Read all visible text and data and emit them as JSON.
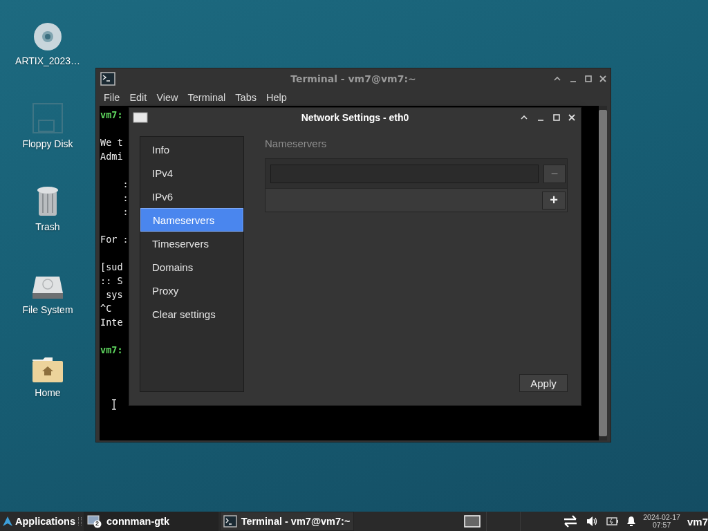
{
  "desktop_icons": [
    {
      "label": "ARTIX_2023…",
      "kind": "disc"
    },
    {
      "label": "Floppy Disk",
      "kind": "floppy"
    },
    {
      "label": "Trash",
      "kind": "trash"
    },
    {
      "label": "File System",
      "kind": "drive"
    },
    {
      "label": "Home",
      "kind": "home"
    }
  ],
  "terminal": {
    "title": "Terminal - vm7@vm7:~",
    "menu": [
      "File",
      "Edit",
      "View",
      "Terminal",
      "Tabs",
      "Help"
    ],
    "blocks": [
      {
        "lines": [
          {
            "text": "vm7:",
            "kind": "prompt"
          }
        ]
      },
      {
        "lines": [
          {
            "text": "We t",
            "kind": "output"
          },
          {
            "text": "Admi",
            "kind": "output"
          }
        ]
      },
      {
        "lines": [
          {
            "text": "    :",
            "kind": "output"
          },
          {
            "text": "    :",
            "kind": "output"
          },
          {
            "text": "    :",
            "kind": "output"
          }
        ]
      },
      {
        "lines": [
          {
            "text": "For :",
            "kind": "output"
          }
        ]
      },
      {
        "lines": [
          {
            "text": "[sud",
            "kind": "output"
          },
          {
            "text": ":: S",
            "kind": "output"
          },
          {
            "text": " sys",
            "kind": "output"
          },
          {
            "text": "^C",
            "kind": "output"
          },
          {
            "text": "Inte",
            "kind": "output"
          }
        ]
      },
      {
        "lines": [
          {
            "text": "vm7:",
            "kind": "prompt"
          }
        ]
      }
    ]
  },
  "dialog": {
    "title": "Network Settings - eth0",
    "sidebar": [
      {
        "label": "Info",
        "selected": false
      },
      {
        "label": "IPv4",
        "selected": false
      },
      {
        "label": "IPv6",
        "selected": false
      },
      {
        "label": "Nameservers",
        "selected": true
      },
      {
        "label": "Timeservers",
        "selected": false
      },
      {
        "label": "Domains",
        "selected": false
      },
      {
        "label": "Proxy",
        "selected": false
      },
      {
        "label": "Clear settings",
        "selected": false
      }
    ],
    "section_title": "Nameservers",
    "remove_button": "−",
    "add_button": "+",
    "apply_button": "Apply"
  },
  "taskbar": {
    "start": "Applications",
    "tasks": [
      {
        "label": "connman-gtk",
        "badge": "2",
        "kind": "window",
        "selected": true
      },
      {
        "label": "Terminal - vm7@vm7:~",
        "kind": "terminal",
        "selected": false
      }
    ],
    "clock": {
      "date": "2024-02-17",
      "time": "07:57"
    },
    "user": "vm7"
  }
}
